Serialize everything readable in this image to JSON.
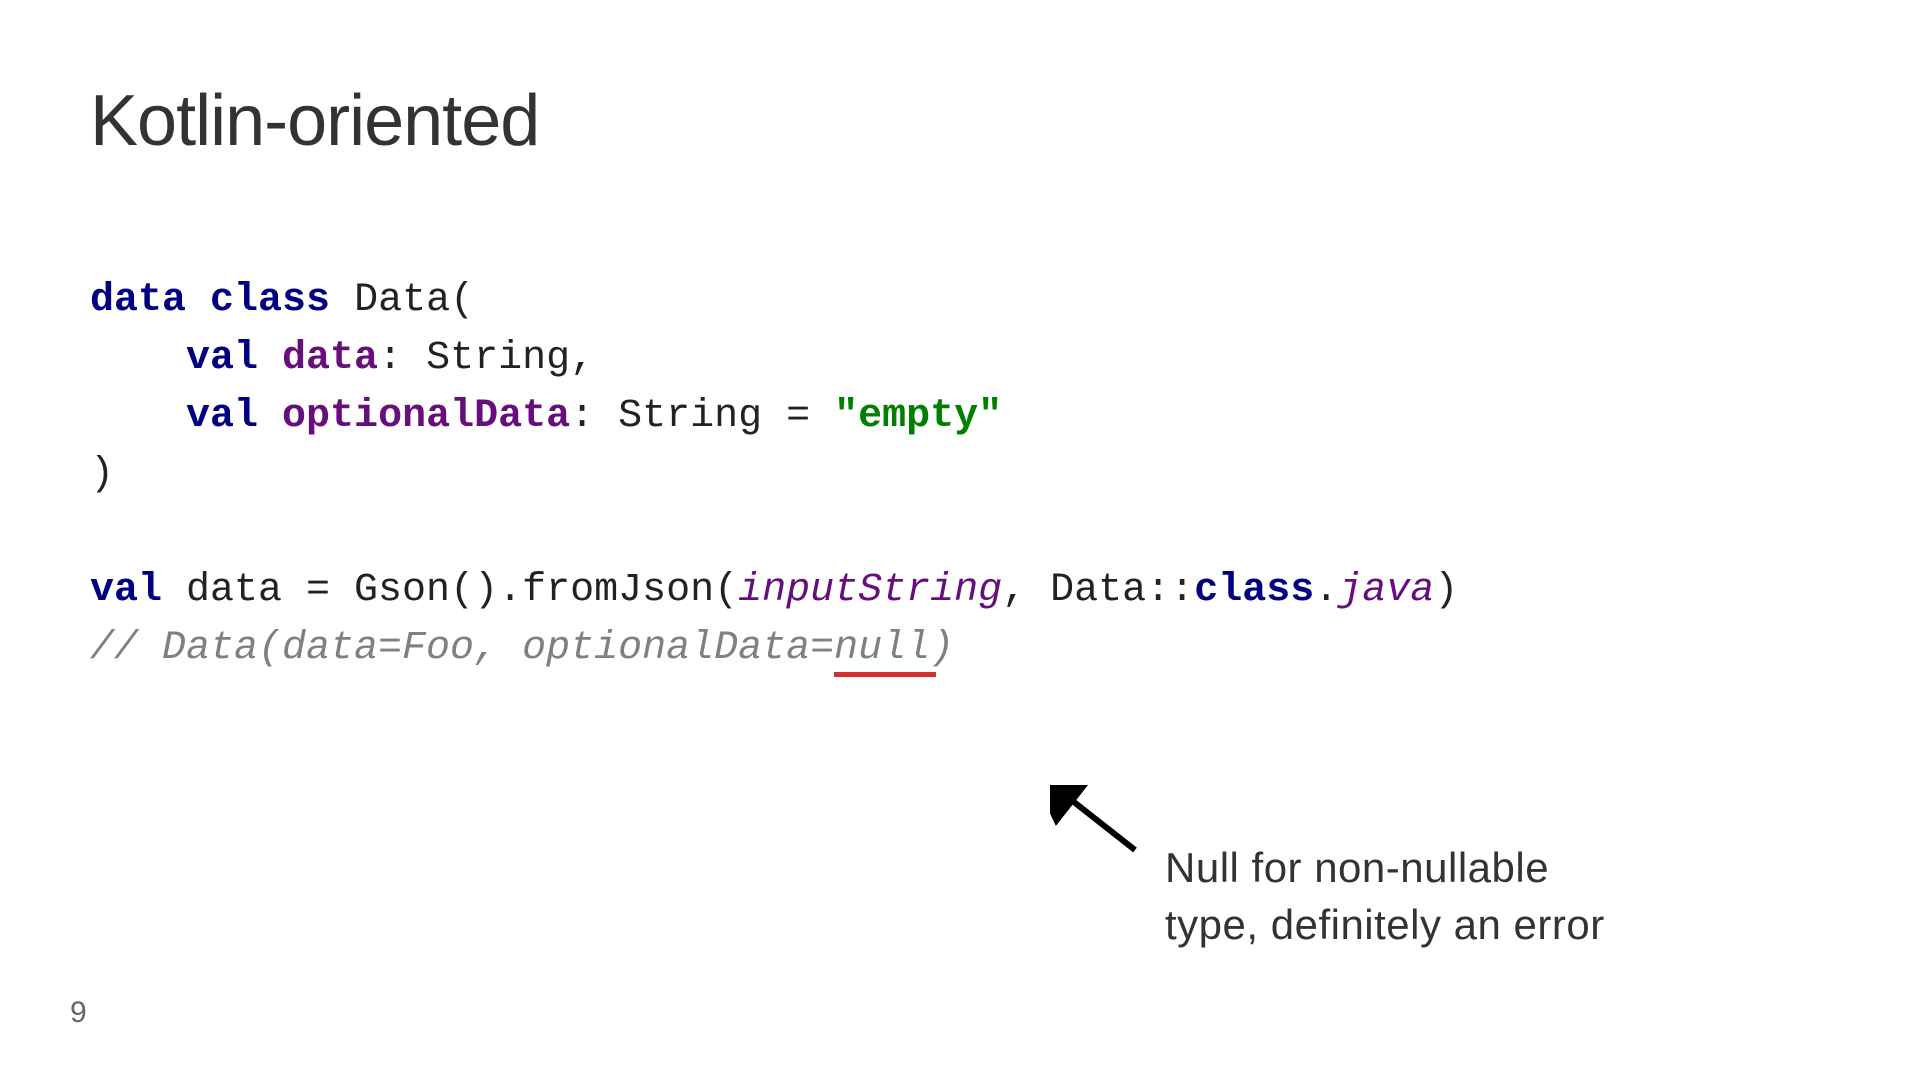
{
  "title": "Kotlin-oriented",
  "code": {
    "kw_data": "data",
    "kw_class": "class",
    "class_name": " Data(",
    "indent": "    ",
    "kw_val": "val",
    "prop_data": "data",
    "type_string1": ": String,",
    "prop_optional": "optionalData",
    "type_string2": ": String = ",
    "str_empty": "\"empty\"",
    "close_paren": ")",
    "line_val": "val",
    "line_rest1": " data = Gson().fromJson(",
    "input_string": "inputString",
    "line_rest2": ", Data::",
    "class_kw": "class",
    "dot": ".",
    "java_prop": "java",
    "close2": ")",
    "comment_prefix": "// Data(data=Foo, optionalData=",
    "comment_null": "null",
    "comment_suffix": ")"
  },
  "annotation": {
    "line1": "Null for non-nullable",
    "line2": "type, definitely an error"
  },
  "page_number": "9"
}
